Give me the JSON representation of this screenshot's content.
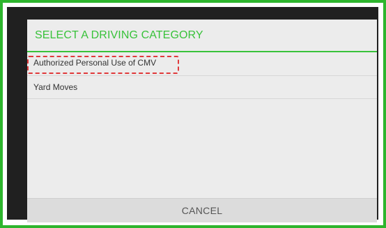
{
  "dialog": {
    "title": "SELECT A DRIVING CATEGORY",
    "items": [
      {
        "label": "Authorized Personal Use of CMV"
      },
      {
        "label": "Yard Moves"
      }
    ],
    "cancel_label": "CANCEL"
  },
  "colors": {
    "accent": "#38c23a",
    "frame": "#2db52d",
    "highlight": "#e0393b",
    "dialog_bg": "#ececec",
    "device_bezel": "#202020"
  }
}
